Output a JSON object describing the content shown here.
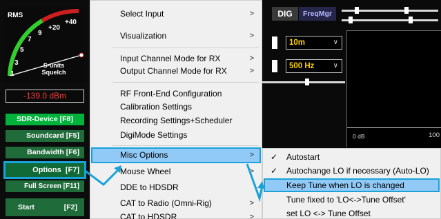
{
  "smeter": {
    "mode_label": "RMS",
    "scale": [
      "+40",
      "+20",
      "9",
      "7",
      "5",
      "3",
      "1"
    ],
    "unit_label": "S-units",
    "squelch_label": "Squelch",
    "value": "-139.0 dBm"
  },
  "left_buttons": {
    "sdr_device": "SDR-Device [F8]",
    "soundcard": "Soundcard [F5]",
    "bandwidth": "Bandwidth [F6]",
    "options": "Options",
    "options_key": "[F7]",
    "full_screen": "Full Screen [F11]",
    "start": "Start",
    "start_key": "[F2]"
  },
  "radio_panel": {
    "dig_label": "DIG",
    "freqmgr_label": "FreqMgr",
    "band_value": "10m",
    "bandwidth_value": "500 Hz",
    "spectrum_db_label": "0 dB",
    "spectrum_scale_label": "100"
  },
  "main_menu": {
    "items": [
      {
        "label": "Select Input",
        "submenu": true
      },
      {
        "label": "Visualization",
        "submenu": true
      },
      {
        "label": "Input Channel Mode for RX",
        "submenu": true
      },
      {
        "label": "Output Channel Mode for RX",
        "submenu": true
      },
      {
        "label": "RF Front-End Configuration",
        "submenu": false
      },
      {
        "label": "Calibration Settings",
        "submenu": false
      },
      {
        "label": "Recording Settings+Scheduler",
        "submenu": false
      },
      {
        "label": "DigiMode Settings",
        "submenu": false
      },
      {
        "label": "Misc Options",
        "submenu": true,
        "highlighted": true
      },
      {
        "label": "Mouse Wheel",
        "submenu": true
      },
      {
        "label": "DDE to HDSDR",
        "submenu": false
      },
      {
        "label": "CAT to Radio (Omni-Rig)",
        "submenu": true
      },
      {
        "label": "CAT to HDSDR",
        "submenu": true
      }
    ],
    "arrow": ">"
  },
  "misc_submenu": {
    "items": [
      {
        "label": "Autostart",
        "checked": true
      },
      {
        "label": "Autochange LO if necessary (Auto-LO)",
        "checked": true
      },
      {
        "label": "Keep Tune when LO is changed",
        "checked": false,
        "highlighted": true
      },
      {
        "label": "Tune fixed to 'LO<->Tune Offset'",
        "checked": false
      },
      {
        "label": "set LO <-> Tune Offset",
        "checked": false
      }
    ],
    "check_glyph": "✓"
  },
  "colors": {
    "highlight": "#91c9f7",
    "annotation": "#1aa2d8",
    "menu_bg": "#f0f0f0",
    "sdr_button": "#00b23b",
    "dbm_text": "#ff3b3b",
    "select_text": "#ffd400"
  },
  "icons": [
    "chevron-right-icon",
    "checkmark-icon",
    "dropdown-chevron-icon"
  ]
}
